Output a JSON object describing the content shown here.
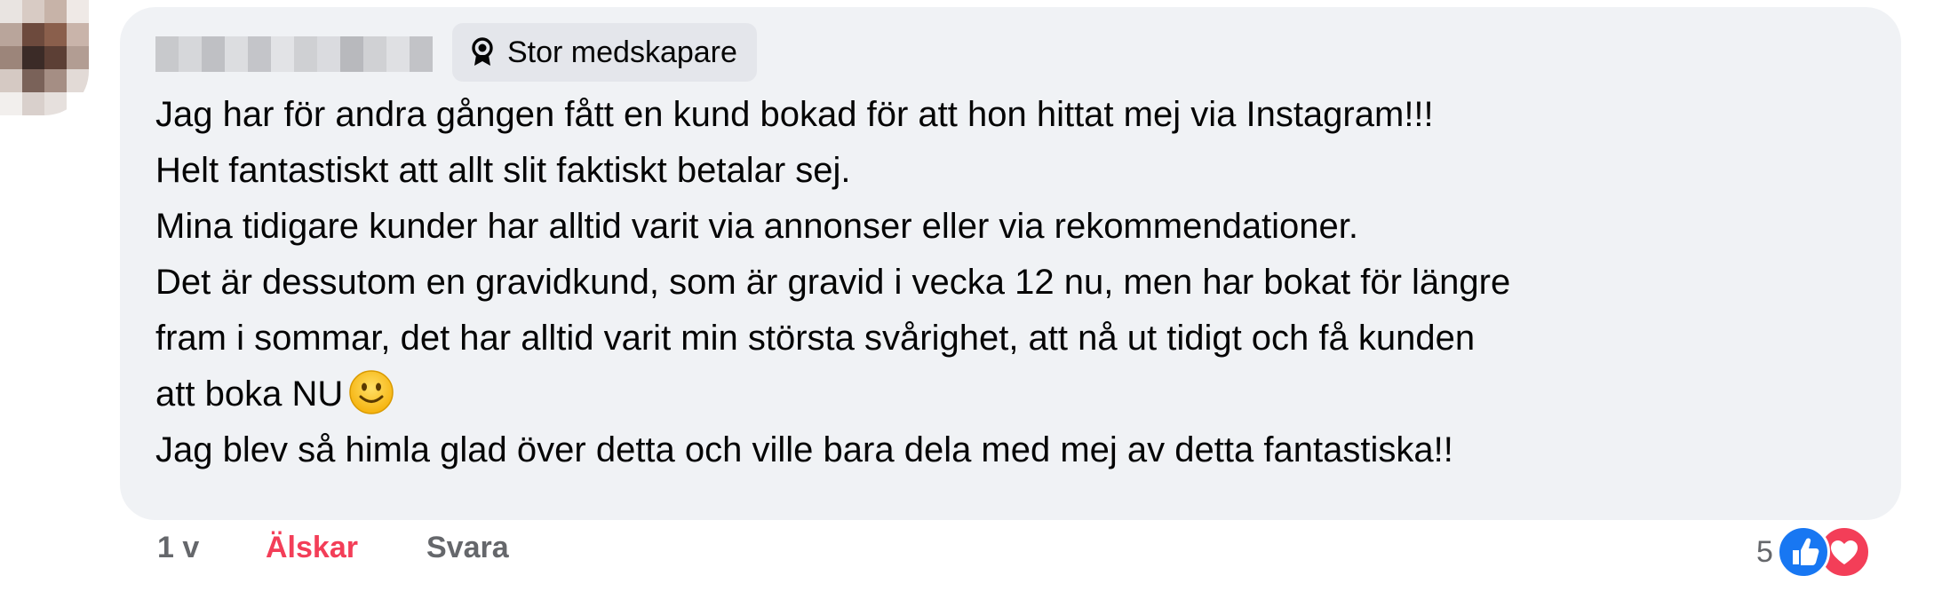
{
  "comment": {
    "badge": {
      "icon": "award-icon",
      "label": "Stor medskapare"
    },
    "lines": [
      "Jag har för andra gången fått en kund bokad för att hon hittat mej via Instagram!!!",
      "Helt fantastiskt att allt slit faktiskt betalar sej.",
      "Mina tidigare kunder har alltid varit via annonser eller via rekommendationer.",
      "Det är dessutom en gravidkund, som är gravid i vecka 12 nu, men har bokat för längre",
      "fram i sommar, det har alltid varit min största svårighet, att nå ut tidigt och få kunden",
      "att boka NU",
      "Jag blev så himla glad över detta och ville bara dela med mej av detta fantastiska!!"
    ],
    "emoji": "smiling-face-emoji"
  },
  "actions": {
    "time": "1 v",
    "love_label": "Älskar",
    "reply_label": "Svara"
  },
  "reactions": {
    "count": "5",
    "types": [
      "like-icon",
      "heart-icon"
    ]
  },
  "colors": {
    "bubble": "#f0f2f5",
    "badge_bg": "#e4e6eb",
    "love": "#f33e58",
    "like": "#1877f2",
    "meta": "#65676b"
  }
}
